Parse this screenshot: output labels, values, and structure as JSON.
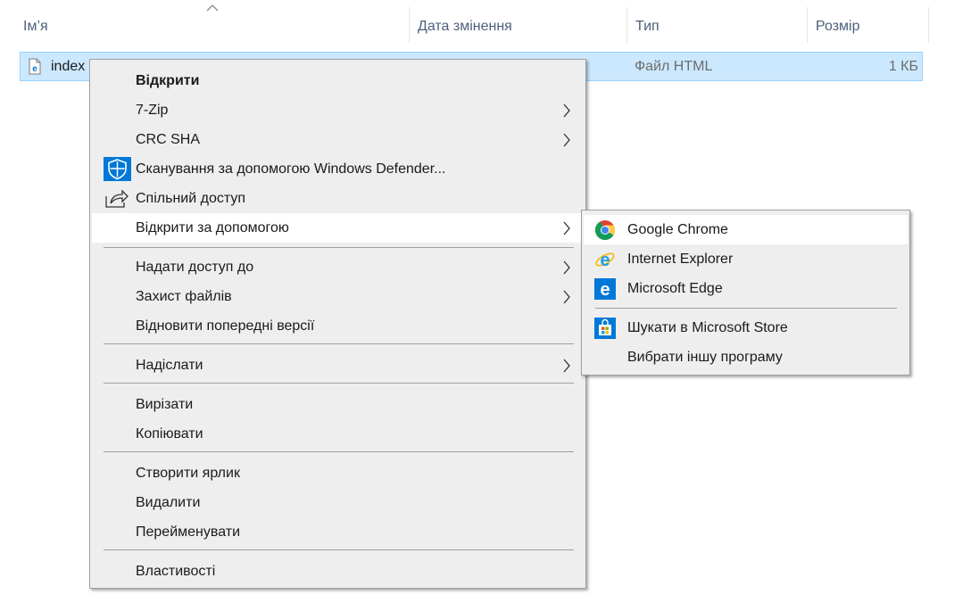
{
  "columns": {
    "name": "Ім’я",
    "date": "Дата змінення",
    "type": "Тип",
    "size": "Розмір"
  },
  "file": {
    "name": "index",
    "type": "Файл HTML",
    "size": "1 КБ",
    "icon": "edge-html-file-icon"
  },
  "menu": {
    "open": "Відкрити",
    "zip": "7-Zip",
    "crc": "CRC SHA",
    "scan": "Сканування за допомогою Windows Defender...",
    "share": "Спільний доступ",
    "open_with": "Відкрити за допомогою",
    "give_access": "Надати доступ до",
    "protect": "Захист файлів",
    "restore": "Відновити попередні версії",
    "send_to": "Надіслати",
    "cut": "Вирізати",
    "copy": "Копіювати",
    "shortcut": "Створити ярлик",
    "delete": "Видалити",
    "rename": "Перейменувати",
    "properties": "Властивості"
  },
  "submenu": {
    "chrome": "Google Chrome",
    "ie": "Internet Explorer",
    "edge": "Microsoft Edge",
    "store": "Шукати в Microsoft Store",
    "other": "Вибрати іншу програму"
  },
  "colors": {
    "selection": "#cce8ff",
    "menu_bg": "#eeeeee",
    "highlight": "#ffffff",
    "accent": "#0078d7"
  }
}
